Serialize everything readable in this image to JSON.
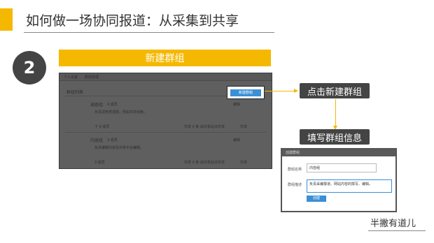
{
  "slide": {
    "title": "如何做一场协同报道：从采集到共享",
    "step_number": "2",
    "step_title": "新建群组",
    "footer": "半撇有道儿"
  },
  "annotations": {
    "click_label": "点击新建群组",
    "fill_label": "填写群组信息"
  },
  "screenshot_list": {
    "tabs": [
      "个人设置",
      "群组管理"
    ],
    "section_title": "群组列表",
    "new_group_button": "新建群组",
    "groups": [
      {
        "name": "调查组",
        "tag": "4 成员",
        "desc": "负责调查类选题，例如共享线索。",
        "meta": [
          "下 9 成员",
          "共享 0 条 由共享站点共享",
          "共享"
        ],
        "action": "编辑"
      },
      {
        "name": "内容组",
        "tag": "3 成员",
        "desc": "负责编辑内容及日常平台编辑。",
        "meta": [
          "3 成员",
          "共享 0 条 由共享站点共享",
          "共享"
        ],
        "action": "编辑"
      }
    ]
  },
  "screenshot_form": {
    "header": "创建群组",
    "name_label": "群组名称",
    "name_value": "内容组",
    "desc_label": "群组描述",
    "desc_value": "负责采编报道、网站内容的撰写、编辑。",
    "create_button": "创建"
  },
  "colors": {
    "accent": "#f5b800",
    "dark": "#444444",
    "link_blue": "#3a8fd6"
  }
}
